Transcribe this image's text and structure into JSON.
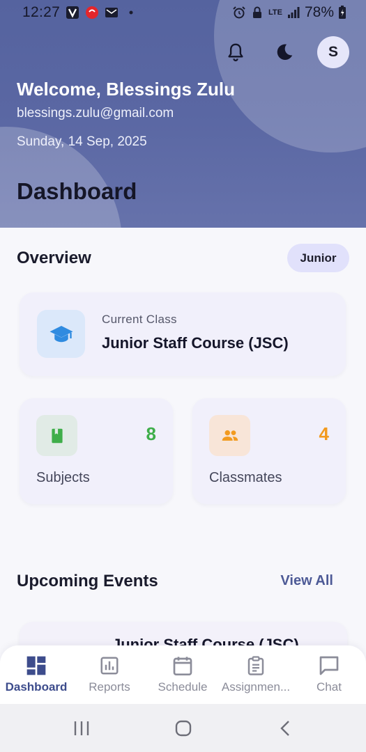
{
  "status_bar": {
    "time": "12:27",
    "network": "LTE",
    "battery": "78%"
  },
  "header": {
    "welcome": "Welcome, Blessings Zulu",
    "email": "blessings.zulu@gmail.com",
    "date": "Sunday, 14 Sep, 2025",
    "title": "Dashboard",
    "avatar_initial": "S"
  },
  "overview": {
    "title": "Overview",
    "badge": "Junior",
    "current_class": {
      "label": "Current Class",
      "value": "Junior Staff Course (JSC)"
    },
    "stats": [
      {
        "label": "Subjects",
        "value": "8",
        "color": "#3fae4a",
        "icon": "book-icon",
        "icon_bg": "#e1ebe6"
      },
      {
        "label": "Classmates",
        "value": "4",
        "color": "#f29a1f",
        "icon": "people-icon",
        "icon_bg": "#f8e5d8"
      }
    ]
  },
  "events": {
    "title": "Upcoming Events",
    "view_all": "View All",
    "items": [
      {
        "title": "Junior Staff Course (JSC)"
      }
    ]
  },
  "bottom_nav": {
    "items": [
      {
        "label": "Dashboard",
        "icon": "dashboard-icon",
        "active": true
      },
      {
        "label": "Reports",
        "icon": "reports-icon",
        "active": false
      },
      {
        "label": "Schedule",
        "icon": "calendar-icon",
        "active": false
      },
      {
        "label": "Assignmen...",
        "icon": "clipboard-icon",
        "active": false
      },
      {
        "label": "Chat",
        "icon": "chat-icon",
        "active": false
      }
    ]
  },
  "colors": {
    "accent": "#3d4c8c",
    "header_bg": "#5a67a3"
  }
}
